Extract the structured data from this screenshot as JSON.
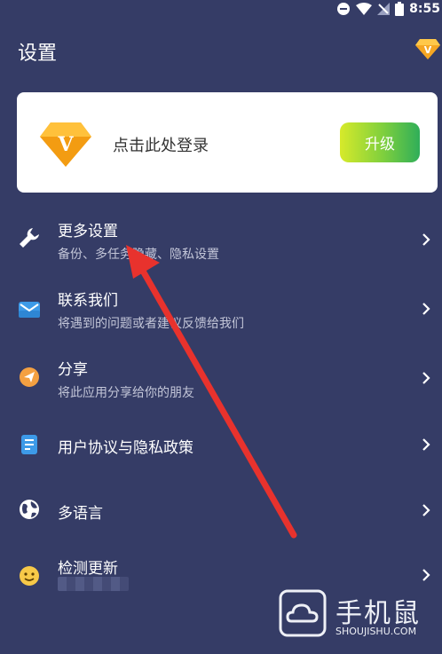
{
  "status_bar": {
    "time": "8:55"
  },
  "header": {
    "title": "设置"
  },
  "login_card": {
    "prompt": "点击此处登录",
    "upgrade_label": "升级",
    "badge_letter": "V"
  },
  "menu": [
    {
      "title": "更多设置",
      "subtitle": "备份、多任务隐藏、隐私设置"
    },
    {
      "title": "联系我们",
      "subtitle": "将遇到的问题或者建议反馈给我们"
    },
    {
      "title": "分享",
      "subtitle": "将此应用分享给你的朋友"
    },
    {
      "title": "用户协议与隐私政策",
      "subtitle": ""
    },
    {
      "title": "多语言",
      "subtitle": ""
    },
    {
      "title": "检测更新",
      "subtitle": ""
    }
  ],
  "watermark": {
    "brand": "手机鼠",
    "url": "SHOUJISHU.COM"
  },
  "colors": {
    "background": "#353c66",
    "accent_red": "#e8322d",
    "upgrade_start": "#d7ea2a",
    "upgrade_end": "#2fae59",
    "diamond": "#f5a623"
  }
}
